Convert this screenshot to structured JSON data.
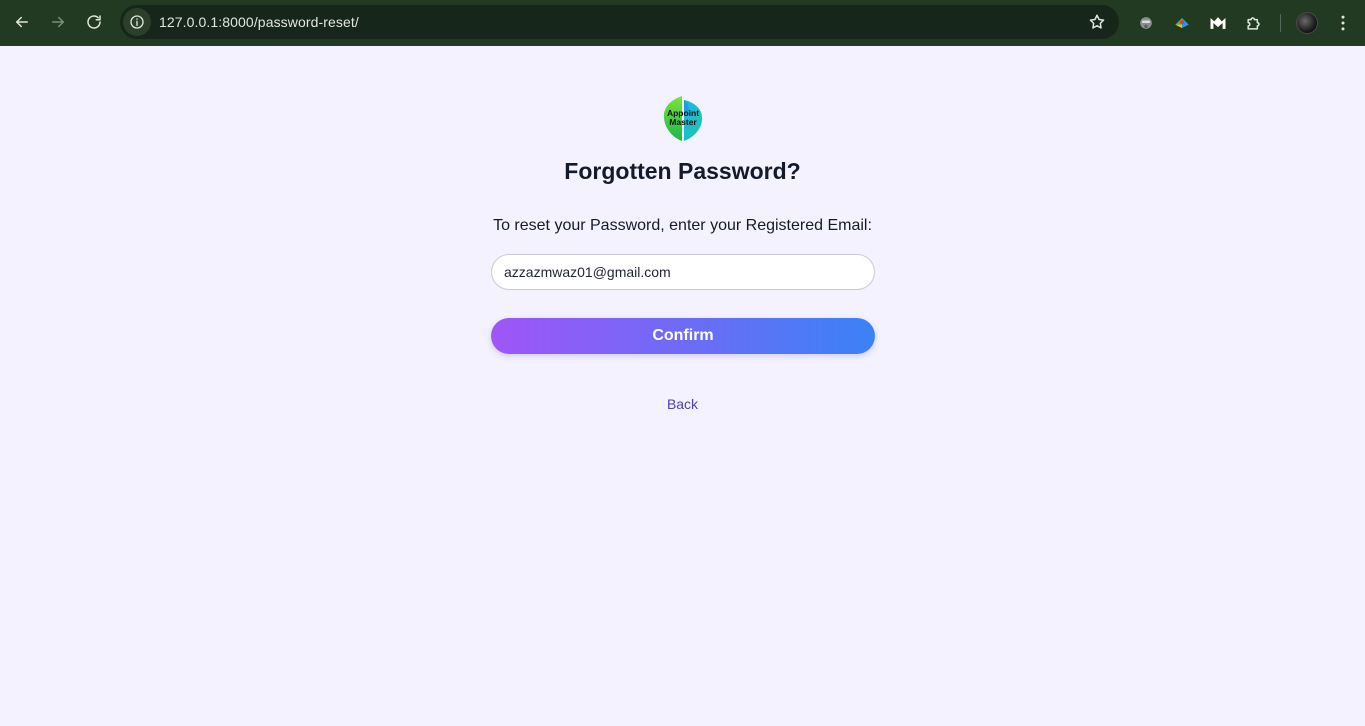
{
  "browser": {
    "url": "127.0.0.1:8000/password-reset/",
    "icons": {
      "back": "arrow-left-icon",
      "forward": "arrow-right-icon",
      "reload": "reload-icon",
      "site_info": "info-icon",
      "bookmark": "star-icon",
      "extensions": "puzzle-icon",
      "menu": "kebab-menu-icon"
    }
  },
  "page": {
    "logo_text": [
      "Appoint",
      "Master"
    ],
    "title": "Forgotten Password?",
    "subtitle": "To reset your Password, enter your Registered Email:",
    "email_value": "azzazmwaz01@gmail.com",
    "confirm_label": "Confirm",
    "back_label": "Back"
  },
  "colors": {
    "background": "#f4f2ff",
    "chrome": "#223a21",
    "button_gradient_start": "#a055f7",
    "button_gradient_end": "#3b82f6",
    "link": "#4b3fb8",
    "title": "#141a2d"
  }
}
